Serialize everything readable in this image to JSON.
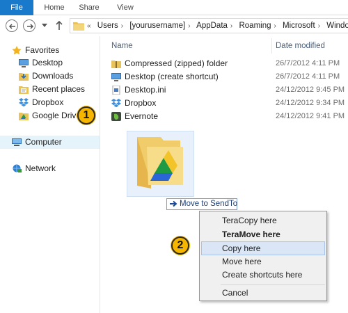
{
  "ribbon": {
    "tabs": [
      "File",
      "Home",
      "Share",
      "View"
    ]
  },
  "address": {
    "crumbs": [
      "Users",
      "[yourusername]",
      "AppData",
      "Roaming",
      "Microsoft",
      "Windows"
    ]
  },
  "navpane": {
    "favorites_label": "Favorites",
    "favorites": [
      {
        "label": "Desktop",
        "icon": "desktop-icon"
      },
      {
        "label": "Downloads",
        "icon": "downloads-icon"
      },
      {
        "label": "Recent places",
        "icon": "recent-places-icon"
      },
      {
        "label": "Dropbox",
        "icon": "dropbox-icon"
      },
      {
        "label": "Google Drive",
        "icon": "google-drive-icon"
      }
    ],
    "computer_label": "Computer",
    "network_label": "Network"
  },
  "columns": {
    "name": "Name",
    "date": "Date modified"
  },
  "files": [
    {
      "name": "Compressed (zipped) folder",
      "date": "26/7/2012 4:11 PM",
      "icon": "zip-folder-icon"
    },
    {
      "name": "Desktop (create shortcut)",
      "date": "26/7/2012 4:11 PM",
      "icon": "desktop-shortcut-icon"
    },
    {
      "name": "Desktop.ini",
      "date": "24/12/2012 9:45 PM",
      "icon": "ini-file-icon"
    },
    {
      "name": "Dropbox",
      "date": "24/12/2012 9:34 PM",
      "icon": "dropbox-icon"
    },
    {
      "name": "Evernote",
      "date": "24/12/2012 9:41 PM",
      "icon": "evernote-icon"
    }
  ],
  "drag_tooltip": "Move to SendTo",
  "context_menu": {
    "items": [
      {
        "label": "TeraCopy here",
        "bold": false,
        "highlighted": false
      },
      {
        "label": "TeraMove here",
        "bold": true,
        "highlighted": false
      },
      {
        "label": "Copy here",
        "bold": false,
        "highlighted": true
      },
      {
        "label": "Move here",
        "bold": false,
        "highlighted": false
      },
      {
        "label": "Create shortcuts here",
        "bold": false,
        "highlighted": false
      },
      {
        "label": "Cancel",
        "bold": false,
        "highlighted": false
      }
    ]
  },
  "callouts": [
    "1",
    "2"
  ],
  "colors": {
    "file_tab": "#1979ca",
    "callout": "#f6b600",
    "menu_highlight": "#dae6f5",
    "date_text": "#6d6d6d",
    "column_header": "#4c607a"
  }
}
